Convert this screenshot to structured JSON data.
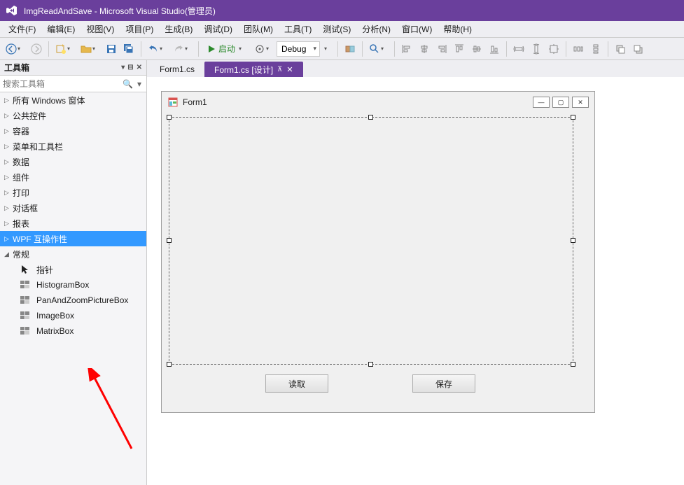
{
  "title": "ImgReadAndSave - Microsoft Visual Studio(管理员)",
  "menu": {
    "file": "文件(F)",
    "edit": "编辑(E)",
    "view": "视图(V)",
    "project": "项目(P)",
    "build": "生成(B)",
    "debug": "调试(D)",
    "team": "团队(M)",
    "tools": "工具(T)",
    "test": "测试(S)",
    "analyze": "分析(N)",
    "window": "窗口(W)",
    "help": "帮助(H)"
  },
  "toolbar": {
    "start_label": "启动",
    "config": "Debug"
  },
  "toolbox": {
    "title": "工具箱",
    "search_placeholder": "搜索工具箱",
    "groups": {
      "all_windows": "所有 Windows 窗体",
      "common": "公共控件",
      "containers": "容器",
      "menus": "菜单和工具栏",
      "data": "数据",
      "components": "组件",
      "print": "打印",
      "dialogs": "对话框",
      "reports": "报表",
      "wpf_interop": "WPF 互操作性",
      "general": "常规"
    },
    "general_items": {
      "pointer": "指针",
      "histogram": "HistogramBox",
      "panzoom": "PanAndZoomPictureBox",
      "imagebox": "ImageBox",
      "matrixbox": "MatrixBox"
    }
  },
  "tabs": {
    "code": "Form1.cs",
    "design": "Form1.cs [设计]"
  },
  "form": {
    "title": "Form1",
    "read_btn": "读取",
    "save_btn": "保存"
  }
}
